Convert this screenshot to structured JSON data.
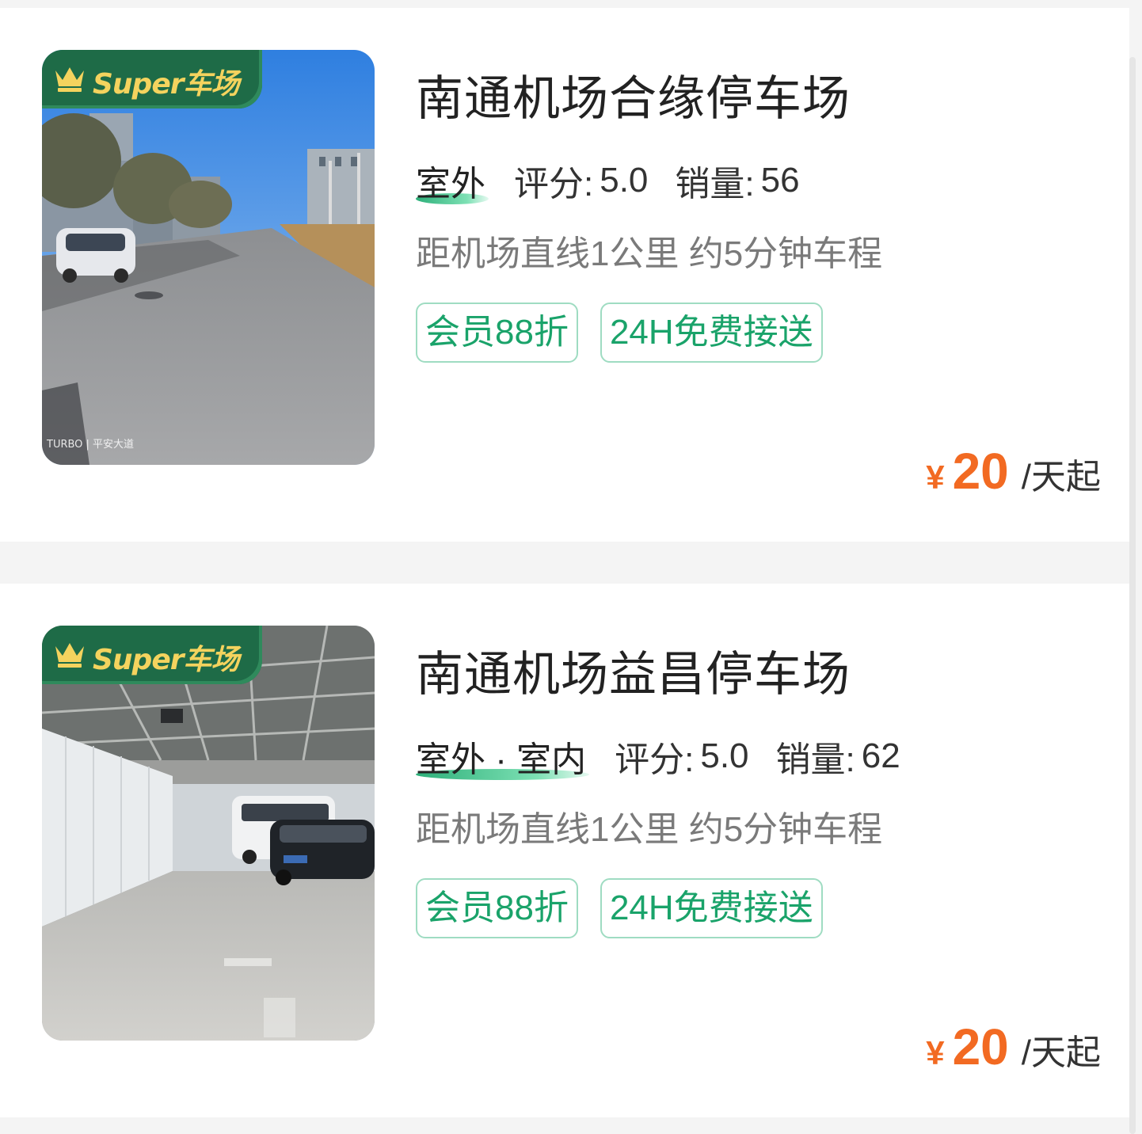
{
  "brand": {
    "super_label": "Super车场",
    "accent_color": "#1e6b47",
    "badge_text_color": "#f4d35e",
    "price_color": "#f26a22",
    "tag_color": "#1aa36a"
  },
  "listings": [
    {
      "name": "南通机场合缘停车场",
      "environment": "室外",
      "rating_label": "评分:",
      "rating": "5.0",
      "sales_label": "销量:",
      "sales": "56",
      "distance": "距机场直线1公里 约5分钟车程",
      "tags": [
        "会员88折",
        "24H免费接送"
      ],
      "currency": "¥",
      "price": "20",
      "price_unit": "/天起",
      "photo": {
        "icon": "outdoor-lot-photo",
        "watermark": "TURBO | 平安大道"
      }
    },
    {
      "name": "南通机场益昌停车场",
      "environment": "室外 · 室内",
      "rating_label": "评分:",
      "rating": "5.0",
      "sales_label": "销量:",
      "sales": "62",
      "distance": "距机场直线1公里 约5分钟车程",
      "tags": [
        "会员88折",
        "24H免费接送"
      ],
      "currency": "¥",
      "price": "20",
      "price_unit": "/天起",
      "photo": {
        "icon": "covered-lot-photo"
      }
    }
  ]
}
